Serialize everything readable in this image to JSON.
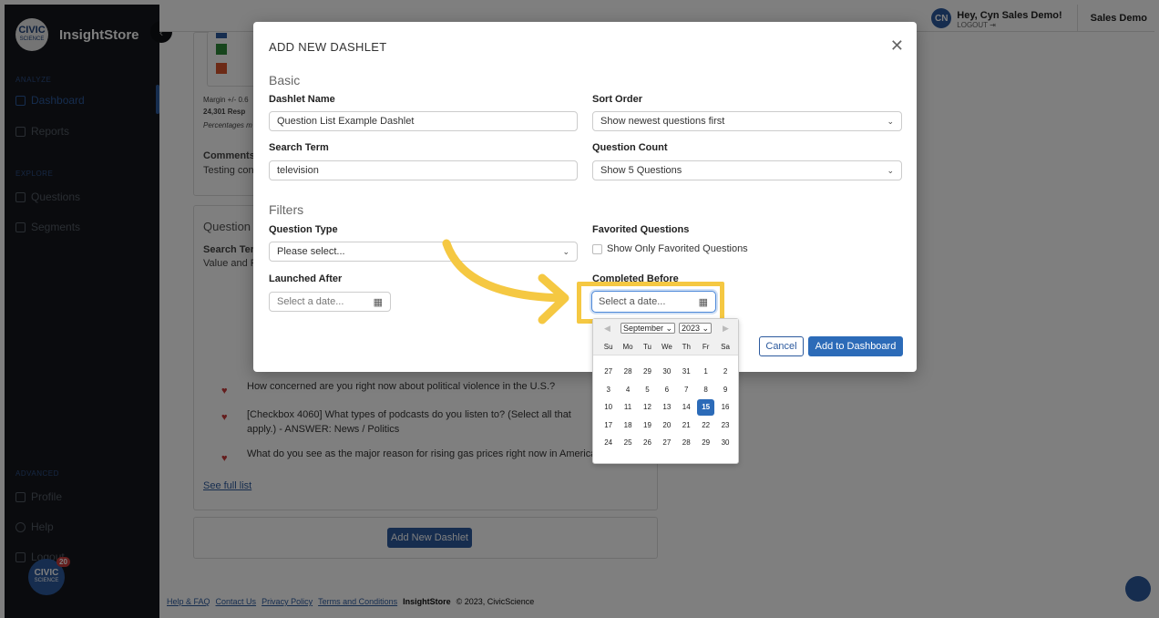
{
  "sidebar": {
    "logo_text": "CIVIC",
    "logo_sub": "SCIENCE",
    "brand": "InsightStore",
    "collapse_glyph": "‹",
    "sections": {
      "analyze": "ANALYZE",
      "explore": "EXPLORE",
      "advanced": "ADVANCED"
    },
    "items": {
      "dashboard": "Dashboard",
      "reports": "Reports",
      "questions": "Questions",
      "segments": "Segments",
      "profile": "Profile",
      "help": "Help",
      "logout": "Logout"
    },
    "badge_text": "CIVIC",
    "badge_sub": "SCIENCE",
    "notification_count": "20"
  },
  "topbar": {
    "avatar_initials": "CN",
    "greeting": "Hey, Cyn Sales Demo!",
    "logout": "LOGOUT ⇥",
    "org": "Sales Demo"
  },
  "background": {
    "margin_text": "Margin +/- 0.6",
    "responses": "24,301 Resp",
    "percentages": "Percentages m",
    "comments_head": "Comments",
    "comments_text": "Testing con",
    "question_head": "Question",
    "search_term_head": "Search Ter",
    "value_text": "Value and F",
    "questions": [
      "How concerned are you right now about political violence in the U.S.?",
      "[Checkbox 4060] What types of podcasts do you listen to? (Select all that apply.) - ANSWER: News / Politics",
      "What do you see as the major reason for rising gas prices right now in America"
    ],
    "see_full_list": "See full list",
    "add_new_dashlet": "Add New Dashlet",
    "footer": {
      "help": "Help & FAQ",
      "contact": "Contact Us",
      "privacy": "Privacy Policy",
      "terms": "Terms and Conditions",
      "brand": "InsightStore",
      "copyright": "© 2023, CivicScience"
    }
  },
  "modal": {
    "title": "ADD NEW DASHLET",
    "close": "✕",
    "basic_head": "Basic",
    "filters_head": "Filters",
    "dashlet_name_label": "Dashlet Name",
    "dashlet_name_value": "Question List Example Dashlet",
    "sort_order_label": "Sort Order",
    "sort_order_value": "Show newest questions first",
    "search_term_label": "Search Term",
    "search_term_value": "television",
    "question_count_label": "Question Count",
    "question_count_value": "Show 5 Questions",
    "question_type_label": "Question Type",
    "question_type_value": "Please select...",
    "favorited_label": "Favorited Questions",
    "favorited_check_label": "Show Only Favorited Questions",
    "launched_after_label": "Launched After",
    "launched_after_placeholder": "Select a date...",
    "completed_before_label": "Completed Before",
    "completed_before_placeholder": "Select a date...",
    "cancel": "Cancel",
    "add": "Add to Dashboard"
  },
  "datepicker": {
    "month": "September",
    "year": "2023",
    "prev": "◀",
    "next": "▶",
    "dow": [
      "Su",
      "Mo",
      "Tu",
      "We",
      "Th",
      "Fr",
      "Sa"
    ],
    "days": [
      "27",
      "28",
      "29",
      "30",
      "31",
      "1",
      "2",
      "3",
      "4",
      "5",
      "6",
      "7",
      "8",
      "9",
      "10",
      "11",
      "12",
      "13",
      "14",
      "15",
      "16",
      "17",
      "18",
      "19",
      "20",
      "21",
      "22",
      "23",
      "24",
      "25",
      "26",
      "27",
      "28",
      "29",
      "30"
    ],
    "selected": "15"
  },
  "colors": {
    "accent": "#2c5a9e",
    "highlight": "#f5c842",
    "legend": [
      "#2c5a9e",
      "#2e8a3a",
      "#d8542c"
    ]
  }
}
